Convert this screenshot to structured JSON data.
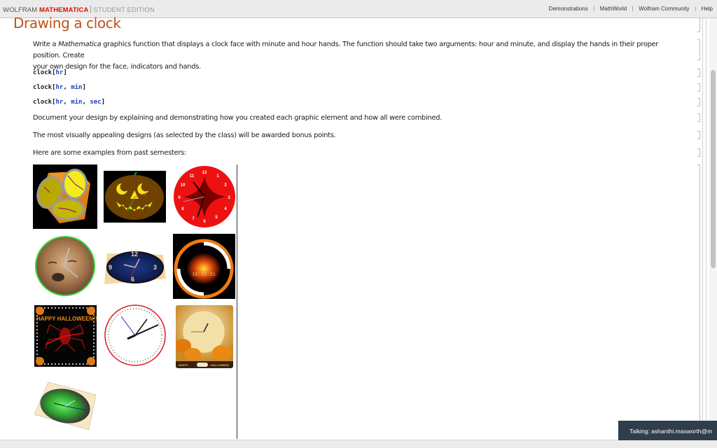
{
  "app": {
    "brand_wolfram": "WOLFRAM",
    "brand_mathematica": "MATHEMATICA",
    "brand_edition": "STUDENT EDITION",
    "links": [
      "Demonstrations",
      "MathWorld",
      "Wolfram Community",
      "Help"
    ]
  },
  "notebook": {
    "title": "Drawing a clock",
    "intro_pre": "Write a ",
    "intro_italic": "Mathematica",
    "intro_post_line1": " graphics function that displays a clock face with minute and hour hands. The function should take two arguments: hour and minute, and display the hands in their proper position. Create",
    "intro_line2": "your own design for the face, indicators and hands.",
    "code_lines": [
      {
        "fn": "clock",
        "args": [
          "hr"
        ]
      },
      {
        "fn": "clock",
        "args": [
          "hr",
          "min"
        ]
      },
      {
        "fn": "clock",
        "args": [
          "hr",
          "min",
          "sec"
        ]
      }
    ],
    "paragraph_document": "Document your design by explaining and demonstrating how you created each graphic element and how all were combined.",
    "paragraph_bonus": "The most visually appealing designs (as selected by the class) will be awarded bonus points.",
    "paragraph_examples": "Here are some examples from past semesters:"
  },
  "gallery": [
    {
      "name": "cube-clock",
      "description": "Orange cube with yellow clock faces"
    },
    {
      "name": "pumpkin-clock",
      "description": "Jack-o-lantern face clock"
    },
    {
      "name": "red-astroid-clock",
      "description": "Red clock with astroid pattern"
    },
    {
      "name": "puppy-clock",
      "description": "Puppy photo clock with green rim"
    },
    {
      "name": "tilted-blue-clock",
      "description": "Tilted navy clock face"
    },
    {
      "name": "scary-pumpkin-clock",
      "description": "Glowing pumpkin digital clock",
      "digital_time": "10:45:31"
    },
    {
      "name": "spider-halloween-clock",
      "description": "Spider clock",
      "banner": "HAPPY HALLOWEEN!!"
    },
    {
      "name": "white-red-clock",
      "description": "White clock with red rim"
    },
    {
      "name": "pumpkins-roman-clock",
      "description": "Roman numeral clock with pumpkins",
      "banner_left": "HAPPY",
      "banner_right": "HALLOWEEN"
    },
    {
      "name": "green-3d-clock",
      "description": "Green glowing clock on tilted plane"
    }
  ],
  "red_clock_numbers": [
    "12",
    "1",
    "2",
    "3",
    "4",
    "5",
    "6",
    "7",
    "8",
    "9",
    "10",
    "11"
  ],
  "blue_clock_numbers": [
    "12",
    "3",
    "6",
    "9"
  ],
  "status": {
    "talking": "Talking: ashanthi.maxworth@m"
  },
  "colors": {
    "title": "#c1521a",
    "brand_red": "#dd1100",
    "code_blue": "#1b3bbf",
    "talk_bg": "#2f3e4a"
  }
}
